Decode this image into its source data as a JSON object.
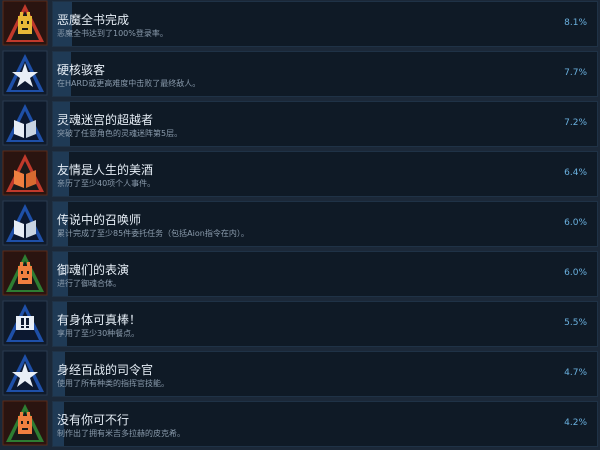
{
  "colors": {
    "background": "#1b2838",
    "panel": "#0f1a26",
    "progress_fill": "#1f3a55",
    "percent_text": "#6ab0de"
  },
  "achievements": [
    {
      "title": "恶魔全书完成",
      "description": "恶魔全书达到了100%登录率。",
      "percent": "8.1%",
      "progress": 0.081,
      "icon": "gold-demon-emblem-icon"
    },
    {
      "title": "硬核骇客",
      "description": "在HARD或更高难度中击败了最终敌人。",
      "percent": "7.7%",
      "progress": 0.077,
      "icon": "blue-star-emblem-icon"
    },
    {
      "title": "灵魂迷宫的超越者",
      "description": "突破了任意角色的灵魂迷阵第5层。",
      "percent": "7.2%",
      "progress": 0.072,
      "icon": "blue-book-emblem-icon"
    },
    {
      "title": "友情是人生的美酒",
      "description": "亲历了至少40项个人事件。",
      "percent": "6.4%",
      "progress": 0.064,
      "icon": "orange-book-emblem-icon"
    },
    {
      "title": "传说中的召唤师",
      "description": "累计完成了至少85件委托任务（包括Aion指令在内）。",
      "percent": "6.0%",
      "progress": 0.06,
      "icon": "blue-book-emblem-icon"
    },
    {
      "title": "御魂们的表演",
      "description": "进行了御魂合体。",
      "percent": "6.0%",
      "progress": 0.06,
      "icon": "orange-demon-emblem-icon"
    },
    {
      "title": "有身体可真棒！",
      "description": "享用了至少30种餐点。",
      "percent": "5.5%",
      "progress": 0.055,
      "icon": "exclamation-emblem-icon"
    },
    {
      "title": "身经百战的司令官",
      "description": "使用了所有种类的指挥官技能。",
      "percent": "4.7%",
      "progress": 0.047,
      "icon": "blue-star-emblem-icon"
    },
    {
      "title": "没有你可不行",
      "description": "制作出了拥有米吉多拉赫的皮克希。",
      "percent": "4.2%",
      "progress": 0.042,
      "icon": "orange-demon-emblem-icon"
    }
  ]
}
